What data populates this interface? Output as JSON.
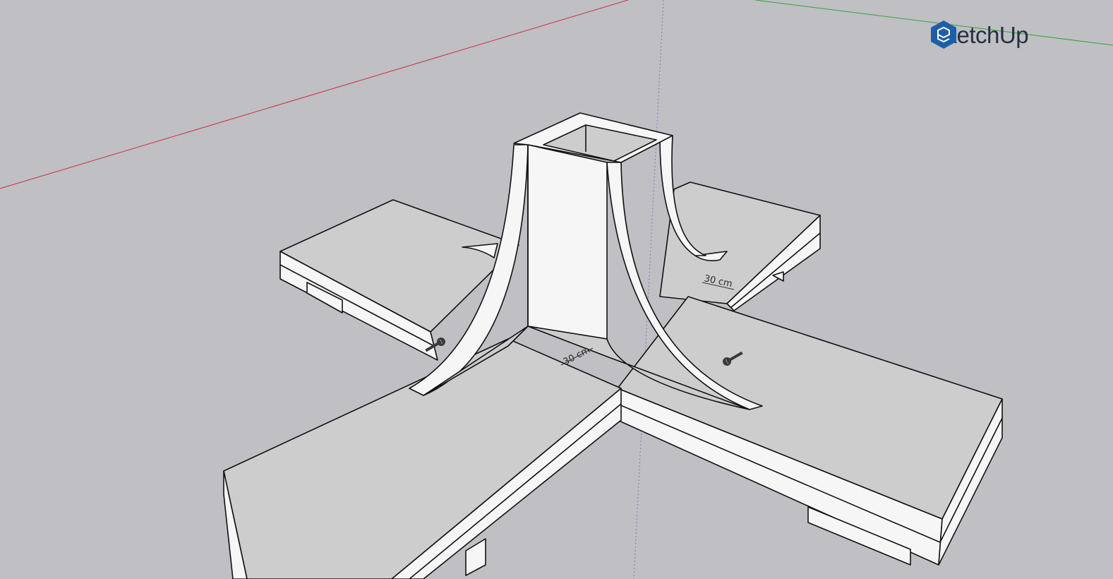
{
  "app": {
    "brand_name": "SketchUp",
    "logo_icon": "sketchup-logo-icon"
  },
  "viewport": {
    "background_color": "#bfbfc4",
    "axes": {
      "red_axis_color": "#c8303a",
      "green_axis_color": "#3aa040",
      "blue_axis_color": "#7a80b8"
    }
  },
  "model": {
    "face_colors": {
      "top": "#cdcdcd",
      "side": "#f6f6f6",
      "edge": "#111111"
    },
    "dimensions": [
      {
        "label": "30 cm"
      },
      {
        "label": "30 cm"
      }
    ],
    "screws": [
      {
        "icon": "screw-icon"
      },
      {
        "icon": "screw-icon"
      }
    ]
  }
}
